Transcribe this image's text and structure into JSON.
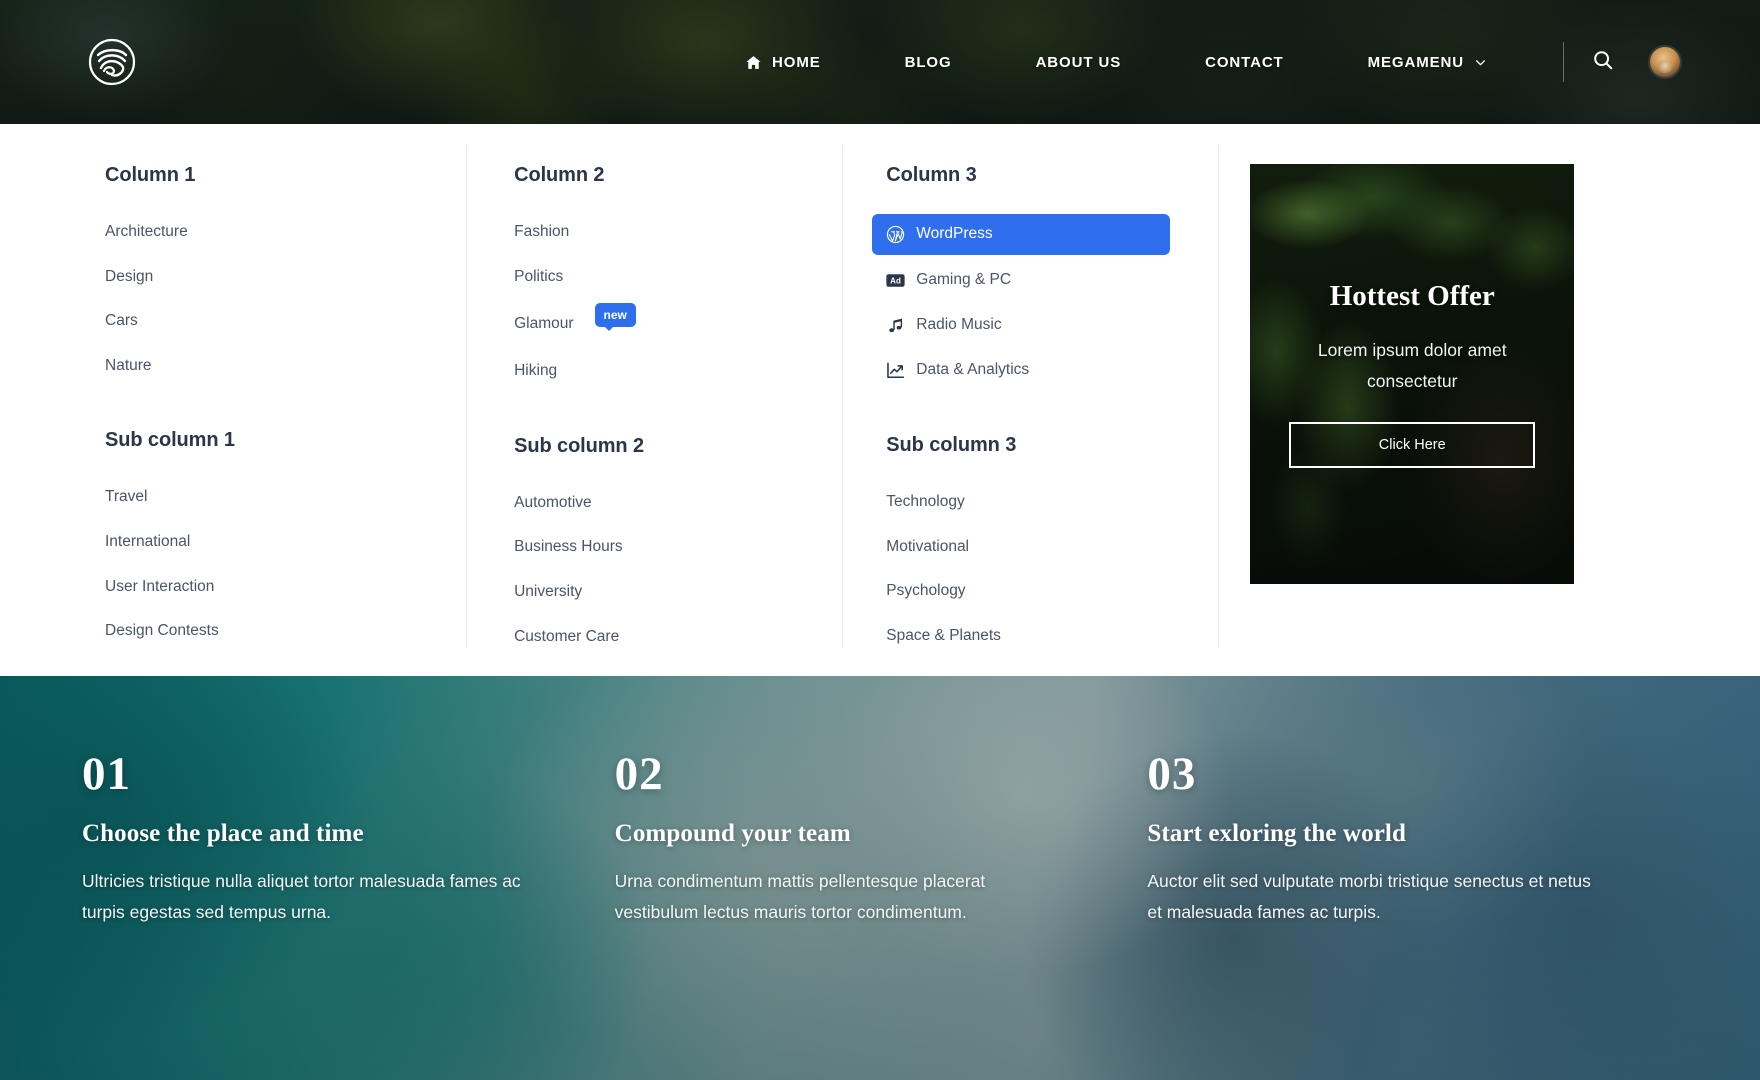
{
  "header": {
    "logo_icon": "wave-circle-logo",
    "nav": [
      {
        "label": "HOME",
        "icon": "home-icon",
        "has_icon": true,
        "has_chevron": false
      },
      {
        "label": "BLOG",
        "icon": "",
        "has_icon": false,
        "has_chevron": false
      },
      {
        "label": "ABOUT US",
        "icon": "",
        "has_icon": false,
        "has_chevron": false
      },
      {
        "label": "CONTACT",
        "icon": "",
        "has_icon": false,
        "has_chevron": false
      },
      {
        "label": "MEGAMENU",
        "icon": "",
        "has_icon": false,
        "has_chevron": true
      }
    ],
    "search_icon": "search-icon",
    "avatar_icon": "user-avatar"
  },
  "megamenu": {
    "columns": [
      {
        "title": "Column 1",
        "links": [
          {
            "label": "Architecture"
          },
          {
            "label": "Design"
          },
          {
            "label": "Cars"
          },
          {
            "label": "Nature"
          }
        ],
        "sub_title": "Sub column 1",
        "sub_links": [
          {
            "label": "Travel"
          },
          {
            "label": "International"
          },
          {
            "label": "User Interaction"
          },
          {
            "label": "Design Contests"
          }
        ]
      },
      {
        "title": "Column 2",
        "links": [
          {
            "label": "Fashion"
          },
          {
            "label": "Politics"
          },
          {
            "label": "Glamour",
            "badge": "new"
          },
          {
            "label": "Hiking"
          }
        ],
        "sub_title": "Sub column 2",
        "sub_links": [
          {
            "label": "Automotive"
          },
          {
            "label": "Business Hours"
          },
          {
            "label": "University"
          },
          {
            "label": "Customer Care"
          }
        ]
      },
      {
        "title": "Column 3",
        "links": [
          {
            "label": "WordPress",
            "icon": "wordpress-icon",
            "active": true
          },
          {
            "label": "Gaming & PC",
            "icon": "ad-badge-icon"
          },
          {
            "label": "Radio Music",
            "icon": "music-note-icon"
          },
          {
            "label": "Data & Analytics",
            "icon": "line-chart-icon"
          }
        ],
        "sub_title": "Sub column 3",
        "sub_links": [
          {
            "label": "Technology"
          },
          {
            "label": "Motivational"
          },
          {
            "label": "Psychology"
          },
          {
            "label": "Space & Planets"
          }
        ]
      }
    ],
    "promo": {
      "title": "Hottest Offer",
      "subtitle": "Lorem ipsum dolor amet consectetur",
      "button_label": "Click Here"
    }
  },
  "features": [
    {
      "number": "01",
      "heading": "Choose the place and time",
      "body": "Ultricies tristique nulla aliquet tortor malesuada fames ac turpis egestas sed tempus urna."
    },
    {
      "number": "02",
      "heading": "Compound your team",
      "body": "Urna condimentum mattis pellentesque placerat vestibulum lectus mauris tortor condimentum."
    },
    {
      "number": "03",
      "heading": "Start exloring the world",
      "body": "Auctor elit sed vulputate morbi tristique senectus et netus et malesuada fames ac turpis."
    }
  ],
  "colors": {
    "accent_blue": "#2f6fed",
    "heading_navy": "#2b3648",
    "link_slate": "#4a5568",
    "teal": "#096062"
  }
}
